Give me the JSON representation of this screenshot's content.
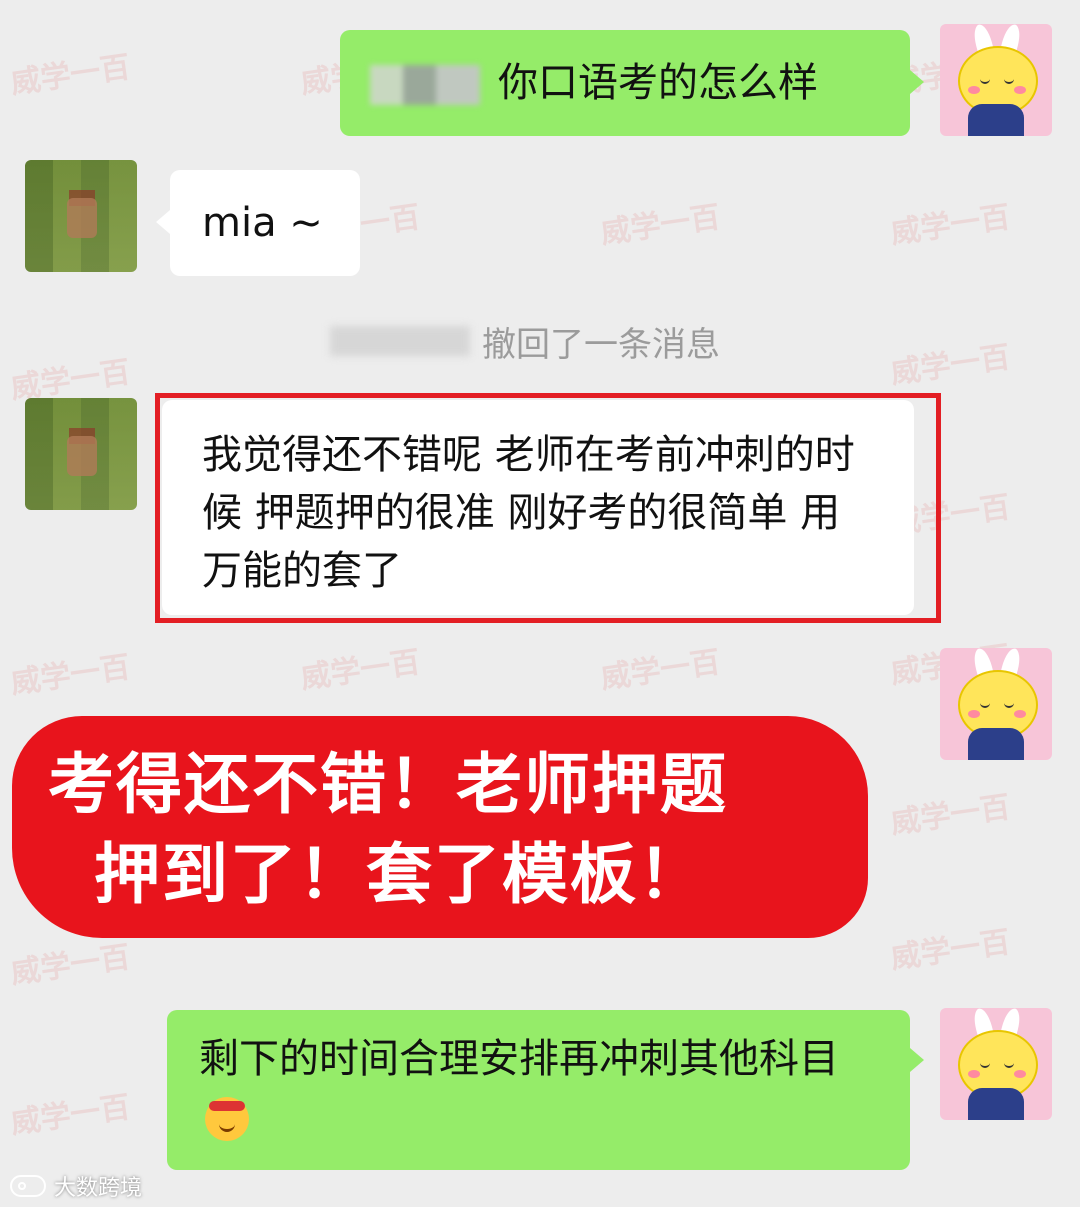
{
  "watermark": {
    "text": "威学一百"
  },
  "messages": [
    {
      "id": "m1",
      "side": "right",
      "text": "你口语考的怎么样"
    },
    {
      "id": "m2",
      "side": "left",
      "text": "mia ~"
    },
    {
      "id": "m3",
      "side": "system",
      "text": "撤回了一条消息"
    },
    {
      "id": "m4",
      "side": "left",
      "text": "我觉得还不错呢 老师在考前冲刺的时候 押题押的很准 刚好考的很简单 用万能的套了"
    },
    {
      "id": "m5",
      "side": "right",
      "text": "剩下的时间合理安排再冲刺其他科目"
    }
  ],
  "banner": {
    "line1": "考得还不错！老师押题",
    "line2": "押到了！套了模板！"
  },
  "footer": {
    "logo_text": "大数跨境"
  },
  "colors": {
    "green_bubble": "#95ec69",
    "highlight": "#e31e24",
    "banner": "#e8141c"
  },
  "icons": {
    "emoji": "emoji-icon",
    "logo": "weibo-logo-icon"
  }
}
